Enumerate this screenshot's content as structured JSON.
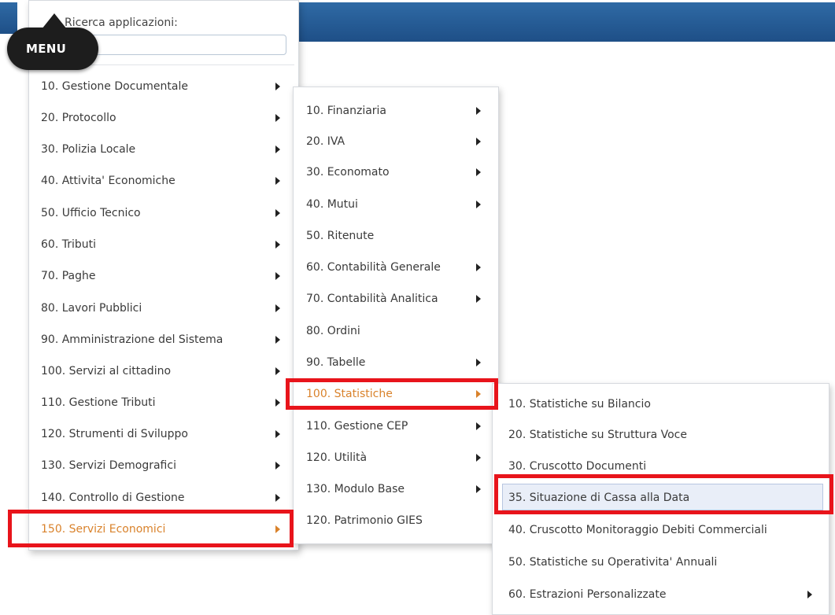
{
  "menu_button": {
    "label": "MENU"
  },
  "search": {
    "label": "Ricerca applicazioni:",
    "value": "",
    "placeholder": ""
  },
  "main_menu": {
    "items": [
      {
        "label": "10. Gestione Documentale",
        "has_submenu": true
      },
      {
        "label": "20. Protocollo",
        "has_submenu": true
      },
      {
        "label": "30. Polizia Locale",
        "has_submenu": true
      },
      {
        "label": "40. Attivita' Economiche",
        "has_submenu": true
      },
      {
        "label": "50. Ufficio Tecnico",
        "has_submenu": true
      },
      {
        "label": "60. Tributi",
        "has_submenu": true
      },
      {
        "label": "70. Paghe",
        "has_submenu": true
      },
      {
        "label": "80. Lavori Pubblici",
        "has_submenu": true
      },
      {
        "label": "90. Amministrazione del Sistema",
        "has_submenu": true
      },
      {
        "label": "100. Servizi al cittadino",
        "has_submenu": true
      },
      {
        "label": "110. Gestione Tributi",
        "has_submenu": true
      },
      {
        "label": "120. Strumenti di Sviluppo",
        "has_submenu": true
      },
      {
        "label": "130. Servizi Demografici",
        "has_submenu": true
      },
      {
        "label": "140. Controllo di Gestione",
        "has_submenu": true
      },
      {
        "label": "150. Servizi Economici",
        "has_submenu": true,
        "active": true
      }
    ]
  },
  "submenu_servizi_economici": {
    "items": [
      {
        "label": "10. Finanziaria",
        "has_submenu": true
      },
      {
        "label": "20. IVA",
        "has_submenu": true
      },
      {
        "label": "30. Economato",
        "has_submenu": true
      },
      {
        "label": "40. Mutui",
        "has_submenu": true
      },
      {
        "label": "50. Ritenute",
        "has_submenu": false
      },
      {
        "label": "60. Contabilità Generale",
        "has_submenu": true
      },
      {
        "label": "70. Contabilità Analitica",
        "has_submenu": true
      },
      {
        "label": "80. Ordini",
        "has_submenu": false
      },
      {
        "label": "90. Tabelle",
        "has_submenu": true
      },
      {
        "label": "100. Statistiche",
        "has_submenu": true,
        "active": true
      },
      {
        "label": "110. Gestione CEP",
        "has_submenu": true
      },
      {
        "label": "120. Utilità",
        "has_submenu": true
      },
      {
        "label": "130. Modulo Base",
        "has_submenu": true
      },
      {
        "label": "120. Patrimonio GIES",
        "has_submenu": false
      }
    ]
  },
  "submenu_statistiche": {
    "items": [
      {
        "label": "10. Statistiche su Bilancio",
        "has_submenu": false
      },
      {
        "label": "20. Statistiche su Struttura Voce",
        "has_submenu": false
      },
      {
        "label": "30. Cruscotto Documenti",
        "has_submenu": false
      },
      {
        "label": "35. Situazione di Cassa alla Data",
        "has_submenu": false,
        "highlighted": true
      },
      {
        "label": "40. Cruscotto Monitoraggio Debiti Commerciali",
        "has_submenu": false
      },
      {
        "label": "50. Statistiche su Operativita' Annuali",
        "has_submenu": false
      },
      {
        "label": "60. Estrazioni Personalizzate",
        "has_submenu": true
      }
    ]
  },
  "colors": {
    "header_blue": "#1e4f87",
    "active_orange": "#d9822b",
    "annotation_red": "#e8141b",
    "hover_blue": "#e9eef8"
  }
}
